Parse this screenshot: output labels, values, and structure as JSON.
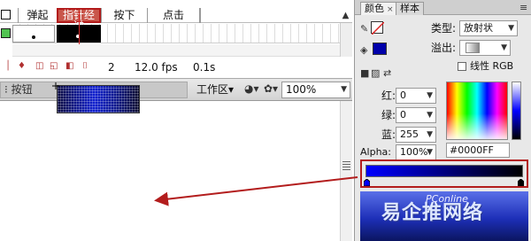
{
  "timeline": {
    "tabs": [
      "弹起",
      "指针经过",
      "按下",
      "点击"
    ],
    "status": {
      "frame": "2",
      "fps": "12.0 fps",
      "time": "0.1s"
    }
  },
  "stagebar": {
    "scene": "按钮",
    "workspace": "工作区",
    "zoom": "100%"
  },
  "color_panel": {
    "tabs": [
      "颜色",
      "样本"
    ],
    "type_label": "类型:",
    "type_value": "放射状",
    "overflow_label": "溢出:",
    "linear_rgb_label": "线性 RGB",
    "red_label": "红:",
    "red_value": "0",
    "green_label": "绿:",
    "green_value": "0",
    "blue_label": "蓝:",
    "blue_value": "255",
    "alpha_label": "Alpha:",
    "alpha_value": "100%",
    "hex_value": "#0000FF",
    "gradient_start": "#0000FF",
    "gradient_end": "#000000"
  },
  "watermark": {
    "text": "易企推网络",
    "brand": "PConline"
  },
  "colors": {
    "selected_tab": "#c9564b",
    "highlight_border": "#b31d1d",
    "layer_color": "#51c451"
  }
}
